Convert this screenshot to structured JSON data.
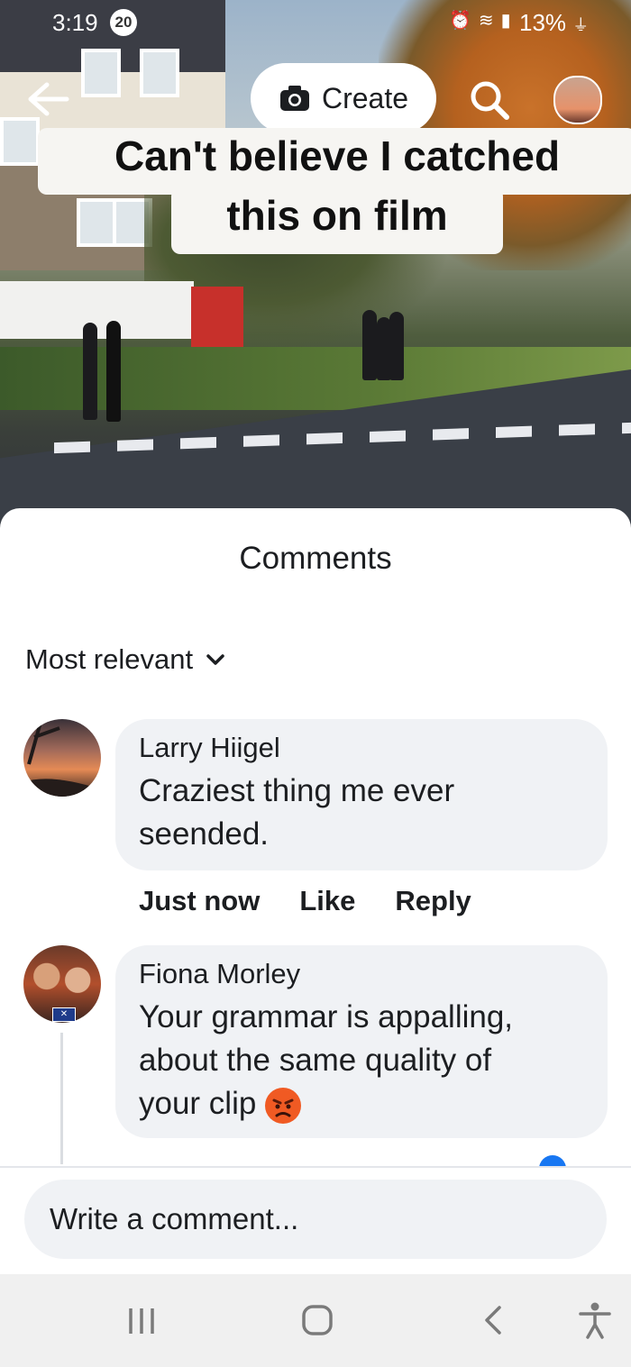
{
  "status_bar": {
    "time": "3:19",
    "notification_count": "20",
    "battery": "13%"
  },
  "top_bar": {
    "create_label": "Create"
  },
  "video": {
    "caption_line1": "Can't believe I catched",
    "caption_line2": "this on film"
  },
  "comments": {
    "title": "Comments",
    "sort_label": "Most relevant",
    "items": [
      {
        "author": "Larry Hiigel",
        "text_line1": "Craziest thing me ever",
        "text_line2": "seended.",
        "time": "Just now",
        "like_label": "Like",
        "reply_label": "Reply"
      },
      {
        "author": "Fiona Morley",
        "text_line1": "Your grammar is appalling,",
        "text_line2": "about the same quality of",
        "text_line3": "your clip"
      }
    ]
  },
  "composer": {
    "placeholder": "Write a comment..."
  },
  "colors": {
    "bubble_bg": "#f0f2f5",
    "text": "#1c1e21",
    "angry_emoji": "#f05a23"
  }
}
